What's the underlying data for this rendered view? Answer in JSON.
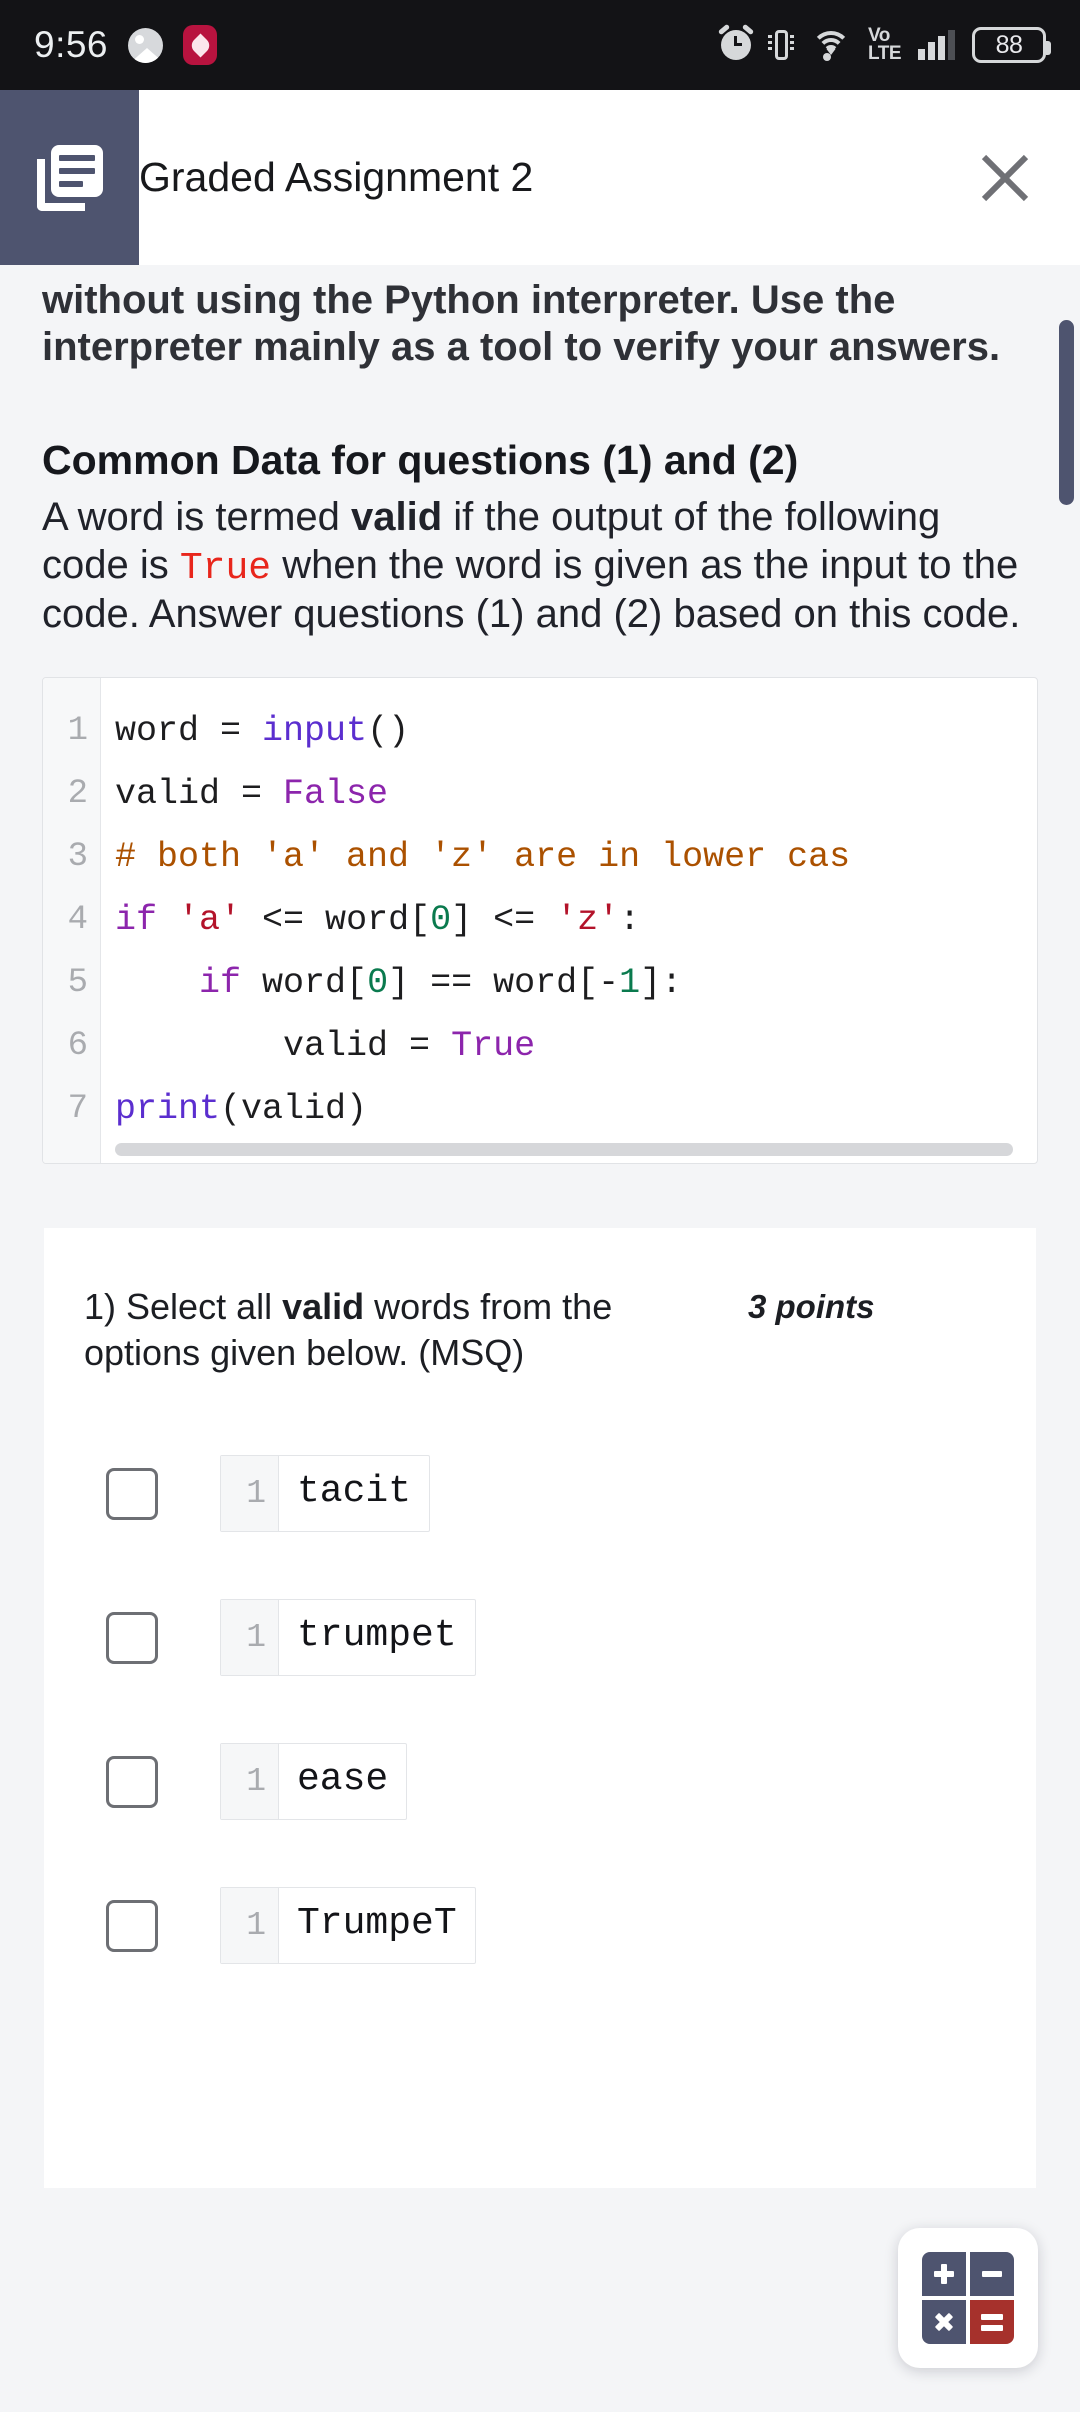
{
  "statusbar": {
    "time": "9:56",
    "battery_level": "88",
    "network_label": "Vo\nLTE",
    "network_line1": "Vo",
    "network_line2": "LTE",
    "icons": [
      "gallery-icon",
      "health-icon",
      "alarm-icon",
      "vibrate-icon",
      "wifi-icon",
      "volte-icon",
      "signal-icon",
      "battery-icon"
    ]
  },
  "appbar": {
    "title": "Graded Assignment 2",
    "logo_icon": "document-library-icon",
    "close_icon": "close-icon"
  },
  "content": {
    "intro_paragraph": "without using the Python interpreter. Use the interpreter mainly as a tool to verify your answers.",
    "section_heading": "Common Data for questions (1) and (2)",
    "body_part1": "A word is termed ",
    "body_bold1": "valid",
    "body_part2": " if the output of the following code is ",
    "body_code": "True",
    "body_part3": " when the word is given as the input to the code. Answer questions (1) and (2) based on this code."
  },
  "code_block": {
    "lines": [
      {
        "no": "1",
        "tokens": [
          {
            "t": "word = ",
            "c": "plain"
          },
          {
            "t": "input",
            "c": "fn"
          },
          {
            "t": "()",
            "c": "plain"
          }
        ]
      },
      {
        "no": "2",
        "tokens": [
          {
            "t": "valid = ",
            "c": "plain"
          },
          {
            "t": "False",
            "c": "kw"
          }
        ]
      },
      {
        "no": "3",
        "tokens": [
          {
            "t": "# both 'a' and 'z' are in lower cas",
            "c": "cm"
          }
        ]
      },
      {
        "no": "4",
        "tokens": [
          {
            "t": "if",
            "c": "kw"
          },
          {
            "t": " ",
            "c": "plain"
          },
          {
            "t": "'a'",
            "c": "st"
          },
          {
            "t": " <= word[",
            "c": "plain"
          },
          {
            "t": "0",
            "c": "nm"
          },
          {
            "t": "] <= ",
            "c": "plain"
          },
          {
            "t": "'z'",
            "c": "st"
          },
          {
            "t": ":",
            "c": "plain"
          }
        ]
      },
      {
        "no": "5",
        "tokens": [
          {
            "t": "    ",
            "c": "plain"
          },
          {
            "t": "if",
            "c": "kw"
          },
          {
            "t": " word[",
            "c": "plain"
          },
          {
            "t": "0",
            "c": "nm"
          },
          {
            "t": "] == word[-",
            "c": "plain"
          },
          {
            "t": "1",
            "c": "nm"
          },
          {
            "t": "]:",
            "c": "plain"
          }
        ]
      },
      {
        "no": "6",
        "tokens": [
          {
            "t": "        valid = ",
            "c": "plain"
          },
          {
            "t": "True",
            "c": "kw"
          }
        ]
      },
      {
        "no": "7",
        "tokens": [
          {
            "t": "print",
            "c": "fn"
          },
          {
            "t": "(valid)",
            "c": "plain"
          }
        ]
      }
    ],
    "full_text": "word = input()\nvalid = False\n# both 'a' and 'z' are in lower case\nif 'a' <= word[0] <= 'z':\n    if word[0] == word[-1]:\n        valid = True\nprint(valid)"
  },
  "question": {
    "number": "1)",
    "text_part1": " Select all ",
    "text_bold": "valid",
    "text_part2": " words from the options given below. (MSQ)",
    "points": "3 points",
    "options": [
      {
        "line_no": "1",
        "word": "tacit",
        "checked": false
      },
      {
        "line_no": "1",
        "word": "trumpet",
        "checked": false
      },
      {
        "line_no": "1",
        "word": "ease",
        "checked": false
      },
      {
        "line_no": "1",
        "word": "TrumpeT",
        "checked": false
      }
    ]
  },
  "fab": {
    "name": "calculator-fab",
    "keys": [
      "+",
      "−",
      "×",
      "="
    ],
    "accent_color": "#4e546f",
    "equals_color": "#a6312c"
  },
  "colors": {
    "brand": "#4e546f",
    "page_bg": "#f4f5f7",
    "card_bg": "#ffffff",
    "code_string": "#b3132a",
    "code_keyword": "#8c25ac",
    "code_function": "#5b2ecf",
    "code_comment": "#ab5100",
    "code_number": "#0a7a4e",
    "true_red": "#e8261c"
  }
}
